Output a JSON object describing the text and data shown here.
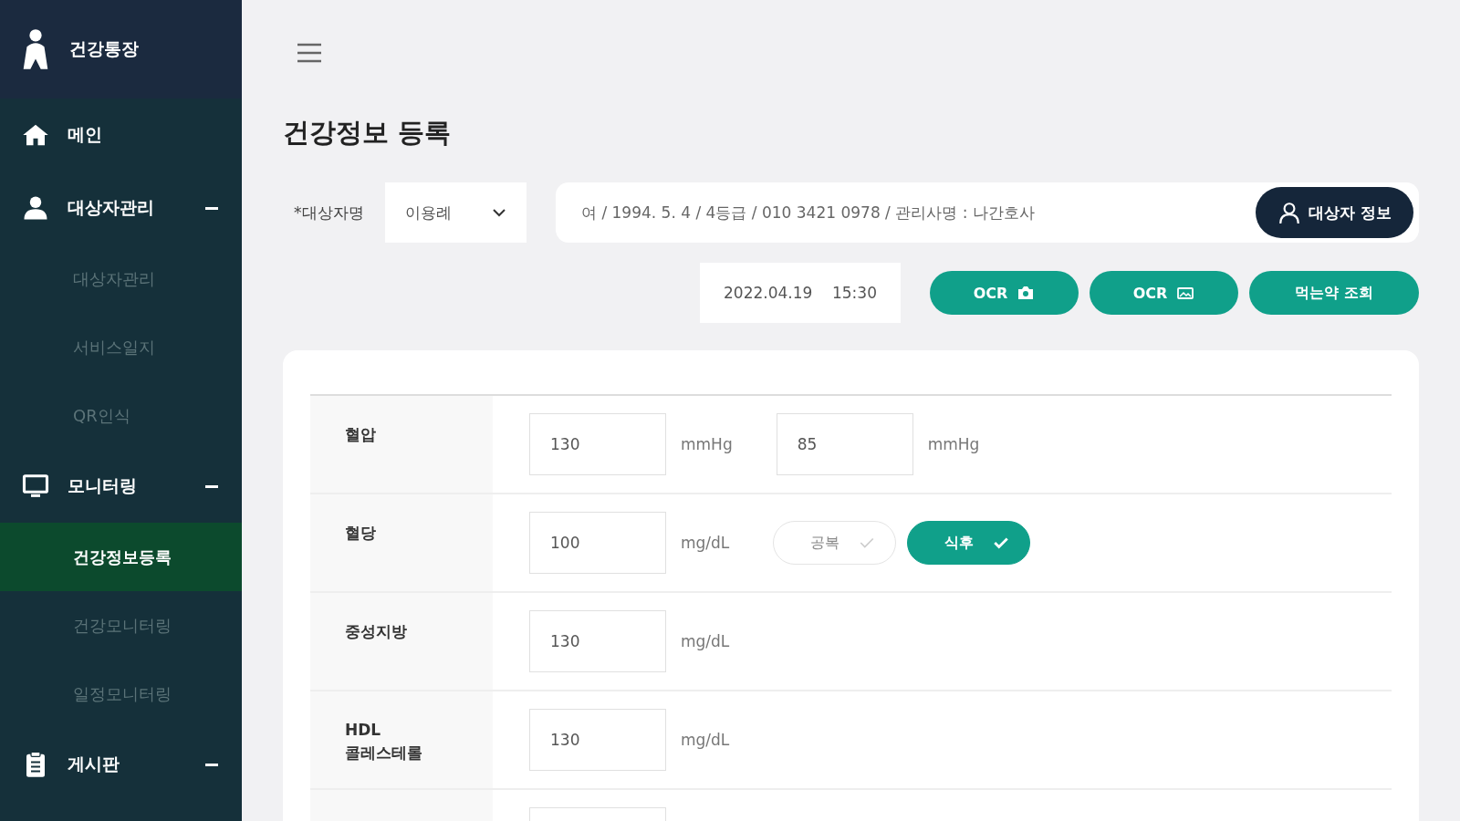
{
  "sidebar": {
    "brand": "건강통장",
    "items": [
      {
        "label": "메인",
        "expanded": false
      },
      {
        "label": "대상자관리",
        "expanded": true,
        "children": [
          {
            "label": "대상자관리",
            "selected": false
          },
          {
            "label": "서비스일지",
            "selected": false
          },
          {
            "label": "QR인식",
            "selected": false
          }
        ]
      },
      {
        "label": "모니터링",
        "expanded": true,
        "children": [
          {
            "label": "건강정보등록",
            "selected": true
          },
          {
            "label": "건강모니터링",
            "selected": false
          },
          {
            "label": "일정모니터링",
            "selected": false
          }
        ]
      },
      {
        "label": "게시판",
        "expanded": true
      }
    ]
  },
  "page_title": "건강정보 등록",
  "subject": {
    "label": "*대상자명",
    "value": "이용례",
    "info": "여 / 1994. 5. 4 / 4등급 / 010 3421 0978 / 관리사명 : 나간호사",
    "info_button": "대상자 정보"
  },
  "datetime": "2022.04.19    15:30",
  "actions": [
    {
      "label": "OCR"
    },
    {
      "label": "OCR"
    },
    {
      "label": "먹는약 조회"
    }
  ],
  "rows": [
    {
      "label": "혈압",
      "fields": [
        {
          "value": "130",
          "unit": "mmHg"
        },
        {
          "value": "85",
          "unit": "mmHg"
        }
      ]
    },
    {
      "label": "혈당",
      "fields": [
        {
          "value": "100",
          "unit": "mg/dL"
        }
      ],
      "chips": [
        {
          "label": "공복",
          "selected": false
        },
        {
          "label": "식후",
          "selected": true
        }
      ]
    },
    {
      "label": "중성지방",
      "fields": [
        {
          "value": "130",
          "unit": "mg/dL"
        }
      ]
    },
    {
      "label": "HDL\n콜레스테롤",
      "fields": [
        {
          "value": "130",
          "unit": "mg/dL"
        }
      ]
    },
    {
      "kind": "cut"
    }
  ]
}
